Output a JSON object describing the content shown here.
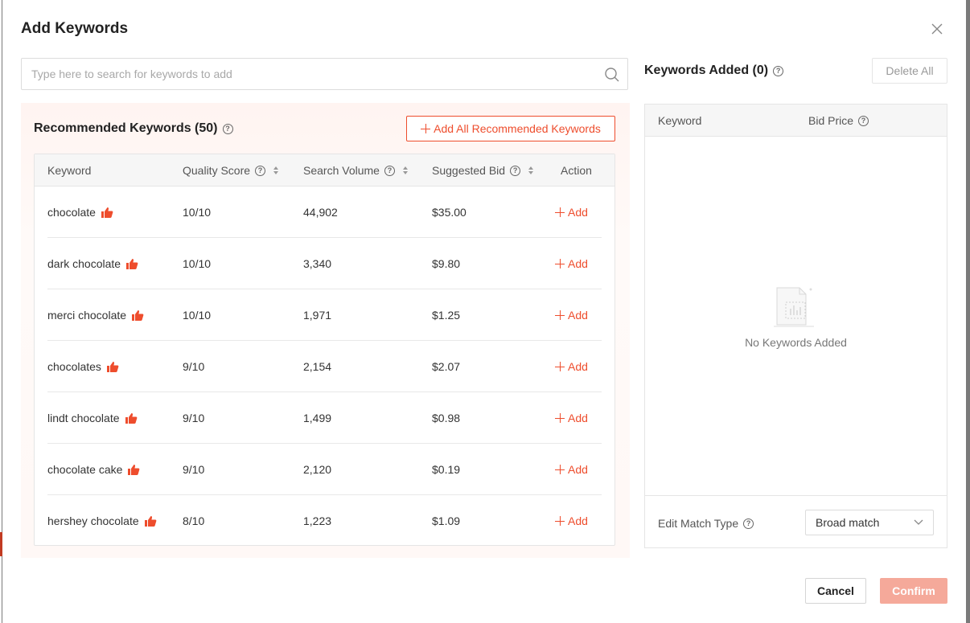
{
  "modal": {
    "title": "Add Keywords"
  },
  "search": {
    "placeholder": "Type here to search for keywords to add"
  },
  "recommended": {
    "title": "Recommended Keywords (50)",
    "add_all_label": "Add All Recommended Keywords",
    "columns": {
      "keyword": "Keyword",
      "quality_score": "Quality Score",
      "search_volume": "Search Volume",
      "suggested_bid": "Suggested Bid",
      "action": "Action"
    },
    "rows": [
      {
        "keyword": "chocolate",
        "quality_score": "10/10",
        "search_volume": "44,902",
        "suggested_bid": "$35.00",
        "action": "Add"
      },
      {
        "keyword": "dark chocolate",
        "quality_score": "10/10",
        "search_volume": "3,340",
        "suggested_bid": "$9.80",
        "action": "Add"
      },
      {
        "keyword": "merci chocolate",
        "quality_score": "10/10",
        "search_volume": "1,971",
        "suggested_bid": "$1.25",
        "action": "Add"
      },
      {
        "keyword": "chocolates",
        "quality_score": "9/10",
        "search_volume": "2,154",
        "suggested_bid": "$2.07",
        "action": "Add"
      },
      {
        "keyword": "lindt chocolate",
        "quality_score": "9/10",
        "search_volume": "1,499",
        "suggested_bid": "$0.98",
        "action": "Add"
      },
      {
        "keyword": "chocolate cake",
        "quality_score": "9/10",
        "search_volume": "2,120",
        "suggested_bid": "$0.19",
        "action": "Add"
      },
      {
        "keyword": "hershey chocolate",
        "quality_score": "8/10",
        "search_volume": "1,223",
        "suggested_bid": "$1.09",
        "action": "Add"
      }
    ]
  },
  "added": {
    "title": "Keywords Added (0)",
    "delete_all_label": "Delete All",
    "columns": {
      "keyword": "Keyword",
      "bid_price": "Bid Price"
    },
    "empty_text": "No Keywords Added",
    "match_type_label": "Edit Match Type",
    "match_type_value": "Broad match"
  },
  "footer": {
    "cancel_label": "Cancel",
    "confirm_label": "Confirm"
  },
  "colors": {
    "accent": "#ee4d2d",
    "confirm_disabled": "#f5a99a"
  },
  "icons": [
    "close-icon",
    "search-icon",
    "help-icon",
    "plus-icon",
    "thumbs-up-icon",
    "sort-icon",
    "empty-document-icon",
    "chevron-down-icon"
  ]
}
